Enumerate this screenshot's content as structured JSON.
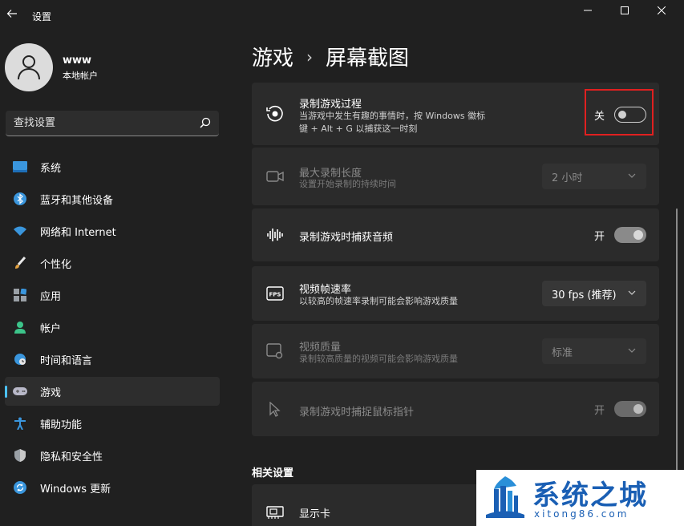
{
  "window": {
    "title": "设置",
    "back_icon": "arrow-left-icon",
    "controls": [
      "minimize-icon",
      "maximize-icon",
      "close-icon"
    ]
  },
  "profile": {
    "name": "www",
    "account_type": "本地帐户"
  },
  "search": {
    "placeholder": "查找设置"
  },
  "sidebar": {
    "items": [
      {
        "label": "系统",
        "icon": "monitor-icon",
        "active": false
      },
      {
        "label": "蓝牙和其他设备",
        "icon": "bluetooth-icon",
        "active": false
      },
      {
        "label": "网络和 Internet",
        "icon": "wifi-icon",
        "active": false
      },
      {
        "label": "个性化",
        "icon": "brush-icon",
        "active": false
      },
      {
        "label": "应用",
        "icon": "apps-icon",
        "active": false
      },
      {
        "label": "帐户",
        "icon": "person-icon",
        "active": false
      },
      {
        "label": "时间和语言",
        "icon": "globe-clock-icon",
        "active": false
      },
      {
        "label": "游戏",
        "icon": "gamepad-icon",
        "active": true
      },
      {
        "label": "辅助功能",
        "icon": "accessibility-icon",
        "active": false
      },
      {
        "label": "隐私和安全性",
        "icon": "shield-icon",
        "active": false
      },
      {
        "label": "Windows 更新",
        "icon": "sync-icon",
        "active": false
      }
    ]
  },
  "breadcrumb": {
    "parent": "游戏",
    "separator": "›",
    "current": "屏幕截图"
  },
  "settings": [
    {
      "title": "录制游戏过程",
      "desc_line1": "当游戏中发生有趣的事情时，按 Windows 徽标",
      "desc_line2": "键 + Alt + G 以捕获这一时刻",
      "control": "toggle",
      "state": "关",
      "enabled": true
    },
    {
      "title": "最大录制长度",
      "desc": "设置开始录制的持续时间",
      "control": "dropdown",
      "value": "2 小时",
      "enabled": false
    },
    {
      "title": "录制游戏时捕获音频",
      "control": "toggle",
      "state": "开",
      "enabled": true
    },
    {
      "title": "视频帧速率",
      "desc": "以较高的帧速率录制可能会影响游戏质量",
      "control": "dropdown",
      "value": "30 fps (推荐)",
      "enabled": true
    },
    {
      "title": "视频质量",
      "desc": "录制较高质量的视频可能会影响游戏质量",
      "control": "dropdown",
      "value": "标准",
      "enabled": false
    },
    {
      "title": "录制游戏时捕捉鼠标指针",
      "control": "toggle",
      "state": "开",
      "enabled": false
    }
  ],
  "related": {
    "heading": "相关设置",
    "items": [
      {
        "title": "显示卡"
      }
    ]
  },
  "watermark": {
    "title": "系统之城",
    "url": "xitong86.com"
  },
  "colors": {
    "background": "#202020",
    "card": "#2b2b2b",
    "accent": "#4cc2ff",
    "highlight": "#e02020",
    "watermark_blue": "#1a5fb4"
  }
}
